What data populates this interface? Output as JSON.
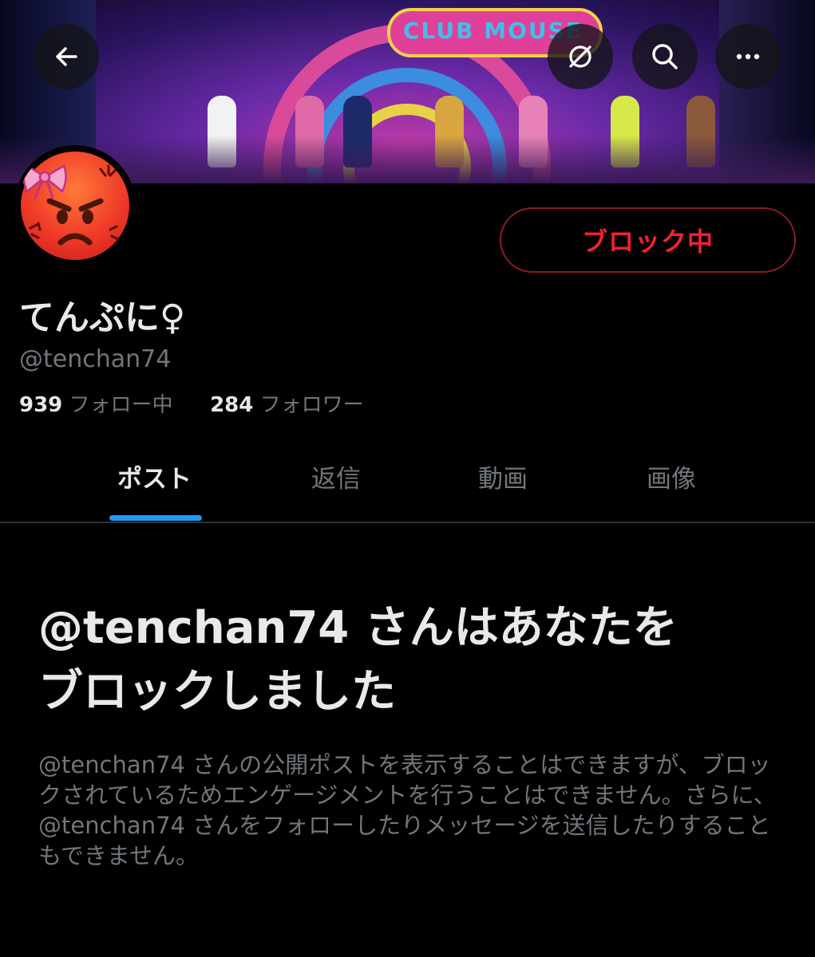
{
  "header": {
    "back_icon": "arrow-left-icon",
    "grok_icon": "slashed-circle-icon",
    "search_icon": "search-icon",
    "more_icon": "more-horizontal-icon",
    "banner_sign_text": "CLUB MOUSE"
  },
  "profile": {
    "avatar_icon": "angry-face-with-bow-emoji",
    "display_name": "てんぷに♀",
    "handle": "@tenchan74",
    "following_count": "939",
    "following_label": "フォロー中",
    "followers_count": "284",
    "followers_label": "フォロワー",
    "block_button_label": "ブロック中"
  },
  "tabs": [
    {
      "label": "ポスト",
      "active": true
    },
    {
      "label": "返信",
      "active": false
    },
    {
      "label": "動画",
      "active": false
    },
    {
      "label": "画像",
      "active": false
    }
  ],
  "blocked_notice": {
    "heading_line1": "@tenchan74 さんはあなたを",
    "heading_line2": "ブロックしました",
    "body": "@tenchan74 さんの公開ポストを表示することはできますが、ブロックされているためエンゲージメントを行うことはできません。さらに、@tenchan74 さんをフォローしたりメッセージを送信したりすることもできません。"
  },
  "colors": {
    "background": "#000000",
    "primary_text": "#e7e9ea",
    "secondary_text": "#71767b",
    "block_red": "#f4212e",
    "accent_blue": "#1d9bf0"
  }
}
